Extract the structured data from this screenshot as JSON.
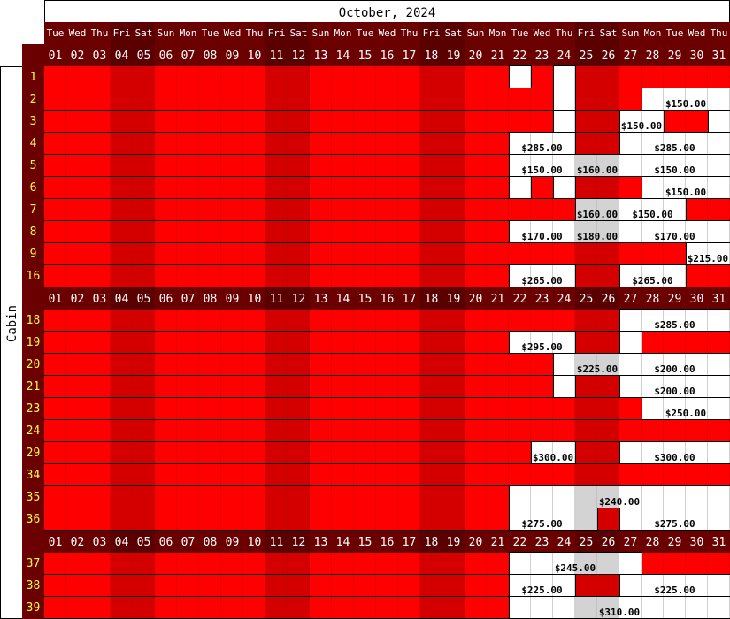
{
  "title": "October, 2024",
  "axis_label": "Cabin",
  "colors": {
    "booked": "#ff0000",
    "booked_weekend": "#d40000",
    "free": "#ffffff",
    "special_rate": "#d3d3d3",
    "header": "#6b0000",
    "header_weekend": "#5a0000",
    "cabin_number": "#ffff33"
  },
  "days": [
    {
      "num": "01",
      "dow": "Tue"
    },
    {
      "num": "02",
      "dow": "Wed"
    },
    {
      "num": "03",
      "dow": "Thu"
    },
    {
      "num": "04",
      "dow": "Fri",
      "weekend": true
    },
    {
      "num": "05",
      "dow": "Sat",
      "weekend": true
    },
    {
      "num": "06",
      "dow": "Sun"
    },
    {
      "num": "07",
      "dow": "Mon"
    },
    {
      "num": "08",
      "dow": "Tue"
    },
    {
      "num": "09",
      "dow": "Wed"
    },
    {
      "num": "10",
      "dow": "Thu"
    },
    {
      "num": "11",
      "dow": "Fri",
      "weekend": true
    },
    {
      "num": "12",
      "dow": "Sat",
      "weekend": true
    },
    {
      "num": "13",
      "dow": "Sun"
    },
    {
      "num": "14",
      "dow": "Mon"
    },
    {
      "num": "15",
      "dow": "Tue"
    },
    {
      "num": "16",
      "dow": "Wed"
    },
    {
      "num": "17",
      "dow": "Thu"
    },
    {
      "num": "18",
      "dow": "Fri",
      "weekend": true
    },
    {
      "num": "19",
      "dow": "Sat",
      "weekend": true
    },
    {
      "num": "20",
      "dow": "Sun"
    },
    {
      "num": "21",
      "dow": "Mon"
    },
    {
      "num": "22",
      "dow": "Tue"
    },
    {
      "num": "23",
      "dow": "Wed"
    },
    {
      "num": "24",
      "dow": "Thu"
    },
    {
      "num": "25",
      "dow": "Fri",
      "weekend": true
    },
    {
      "num": "26",
      "dow": "Sat",
      "weekend": true
    },
    {
      "num": "27",
      "dow": "Sun"
    },
    {
      "num": "28",
      "dow": "Mon"
    },
    {
      "num": "29",
      "dow": "Tue"
    },
    {
      "num": "30",
      "dow": "Wed"
    },
    {
      "num": "31",
      "dow": "Thu"
    }
  ],
  "groups": [
    {
      "cabins": [
        {
          "cabin": "1",
          "cells": {
            "22": "free",
            "24": "free"
          }
        },
        {
          "cabin": "2",
          "cells": {
            "24": "free",
            "28": "free",
            "29": "free",
            "30": "free",
            "31": "free"
          },
          "prices": [
            {
              "text": "$150.00",
              "from": 28,
              "to": 31
            }
          ]
        },
        {
          "cabin": "3",
          "cells": {
            "24": "free",
            "27": "free",
            "28": "free",
            "31": "free"
          },
          "prices": [
            {
              "text": "$150.00",
              "from": 27,
              "to": 28
            }
          ]
        },
        {
          "cabin": "4",
          "cells": {
            "22": "free",
            "23": "free",
            "24": "free",
            "27": "free",
            "28": "free",
            "29": "free",
            "30": "free",
            "31": "free"
          },
          "prices": [
            {
              "text": "$285.00",
              "from": 22,
              "to": 24
            },
            {
              "text": "$285.00",
              "from": 27,
              "to": 31
            }
          ]
        },
        {
          "cabin": "5",
          "cells": {
            "22": "free",
            "23": "free",
            "24": "free",
            "25": "special",
            "26": "special",
            "27": "free",
            "28": "free",
            "29": "free",
            "30": "free",
            "31": "free"
          },
          "prices": [
            {
              "text": "$150.00",
              "from": 22,
              "to": 24
            },
            {
              "text": "$160.00",
              "from": 25,
              "to": 26
            },
            {
              "text": "$150.00",
              "from": 27,
              "to": 31
            }
          ]
        },
        {
          "cabin": "6",
          "cells": {
            "22": "free",
            "24": "free",
            "28": "free",
            "29": "free",
            "30": "free",
            "31": "free"
          },
          "prices": [
            {
              "text": "$150.00",
              "from": 28,
              "to": 31
            }
          ]
        },
        {
          "cabin": "7",
          "cells": {
            "25": "special",
            "26": "special",
            "27": "free",
            "28": "free",
            "29": "free"
          },
          "prices": [
            {
              "text": "$160.00",
              "from": 25,
              "to": 26
            },
            {
              "text": "$150.00",
              "from": 27,
              "to": 29
            }
          ]
        },
        {
          "cabin": "8",
          "cells": {
            "22": "free",
            "23": "free",
            "24": "free",
            "25": "special",
            "26": "special",
            "27": "free",
            "28": "free",
            "29": "free",
            "30": "free",
            "31": "free"
          },
          "prices": [
            {
              "text": "$170.00",
              "from": 22,
              "to": 24
            },
            {
              "text": "$180.00",
              "from": 25,
              "to": 26
            },
            {
              "text": "$170.00",
              "from": 27,
              "to": 31
            }
          ]
        },
        {
          "cabin": "9",
          "cells": {
            "30": "free",
            "31": "free"
          },
          "prices": [
            {
              "text": "$215.00",
              "from": 30,
              "to": 31
            }
          ]
        },
        {
          "cabin": "16",
          "cells": {
            "22": "free",
            "23": "free",
            "24": "free",
            "27": "free",
            "28": "free",
            "29": "free"
          },
          "prices": [
            {
              "text": "$265.00",
              "from": 22,
              "to": 24
            },
            {
              "text": "$265.00",
              "from": 27,
              "to": 29
            }
          ]
        }
      ]
    },
    {
      "cabins": [
        {
          "cabin": "18",
          "cells": {
            "27": "free",
            "28": "free",
            "29": "free",
            "30": "free",
            "31": "free"
          },
          "prices": [
            {
              "text": "$285.00",
              "from": 27,
              "to": 31
            }
          ]
        },
        {
          "cabin": "19",
          "cells": {
            "22": "free",
            "23": "free",
            "24": "free",
            "27": "free"
          },
          "prices": [
            {
              "text": "$295.00",
              "from": 22,
              "to": 24
            }
          ]
        },
        {
          "cabin": "20",
          "cells": {
            "24": "free",
            "25": "special",
            "26": "special",
            "27": "free",
            "28": "free",
            "29": "free",
            "30": "free",
            "31": "free"
          },
          "prices": [
            {
              "text": "$225.00",
              "from": 25,
              "to": 26
            },
            {
              "text": "$200.00",
              "from": 27,
              "to": 31
            }
          ]
        },
        {
          "cabin": "21",
          "cells": {
            "24": "free",
            "27": "free",
            "28": "free",
            "29": "free",
            "30": "free",
            "31": "free"
          },
          "prices": [
            {
              "text": "$200.00",
              "from": 27,
              "to": 31
            }
          ]
        },
        {
          "cabin": "23",
          "cells": {
            "28": "free",
            "29": "free",
            "30": "free",
            "31": "free"
          },
          "prices": [
            {
              "text": "$250.00",
              "from": 28,
              "to": 31
            }
          ]
        },
        {
          "cabin": "24",
          "cells": {}
        },
        {
          "cabin": "29",
          "cells": {
            "23": "free",
            "24": "free",
            "27": "free",
            "28": "free",
            "29": "free",
            "30": "free",
            "31": "free"
          },
          "prices": [
            {
              "text": "$300.00",
              "from": 23,
              "to": 24
            },
            {
              "text": "$300.00",
              "from": 27,
              "to": 31
            }
          ]
        },
        {
          "cabin": "34",
          "cells": {}
        },
        {
          "cabin": "35",
          "cells": {
            "22": "free",
            "23": "free",
            "24": "free",
            "25": "special",
            "26": "special",
            "27": "free",
            "28": "free",
            "29": "free",
            "30": "free",
            "31": "free"
          },
          "prices": [
            {
              "text": "$240.00",
              "from": 22,
              "to": 31
            }
          ]
        },
        {
          "cabin": "36",
          "cells": {
            "22": "free",
            "23": "free",
            "24": "free",
            "25": "special",
            "27": "free",
            "28": "free",
            "29": "free",
            "30": "free",
            "31": "free"
          },
          "prices": [
            {
              "text": "$275.00",
              "from": 22,
              "to": 24
            },
            {
              "text": "$275.00",
              "from": 27,
              "to": 31
            }
          ]
        }
      ]
    },
    {
      "cabins": [
        {
          "cabin": "37",
          "cells": {
            "22": "free",
            "23": "free",
            "24": "free",
            "25": "special",
            "26": "special",
            "27": "free"
          },
          "prices": [
            {
              "text": "$245.00",
              "from": 22,
              "to": 27
            }
          ]
        },
        {
          "cabin": "38",
          "cells": {
            "22": "free",
            "23": "free",
            "24": "free",
            "27": "free",
            "28": "free",
            "29": "free",
            "30": "free",
            "31": "free"
          },
          "prices": [
            {
              "text": "$225.00",
              "from": 22,
              "to": 24
            },
            {
              "text": "$225.00",
              "from": 27,
              "to": 31
            }
          ]
        },
        {
          "cabin": "39",
          "cells": {
            "22": "free",
            "23": "free",
            "24": "free",
            "25": "special",
            "26": "special",
            "27": "free",
            "28": "free",
            "29": "free",
            "30": "free",
            "31": "free"
          },
          "prices": [
            {
              "text": "$310.00",
              "from": 22,
              "to": 31
            }
          ]
        }
      ]
    }
  ]
}
